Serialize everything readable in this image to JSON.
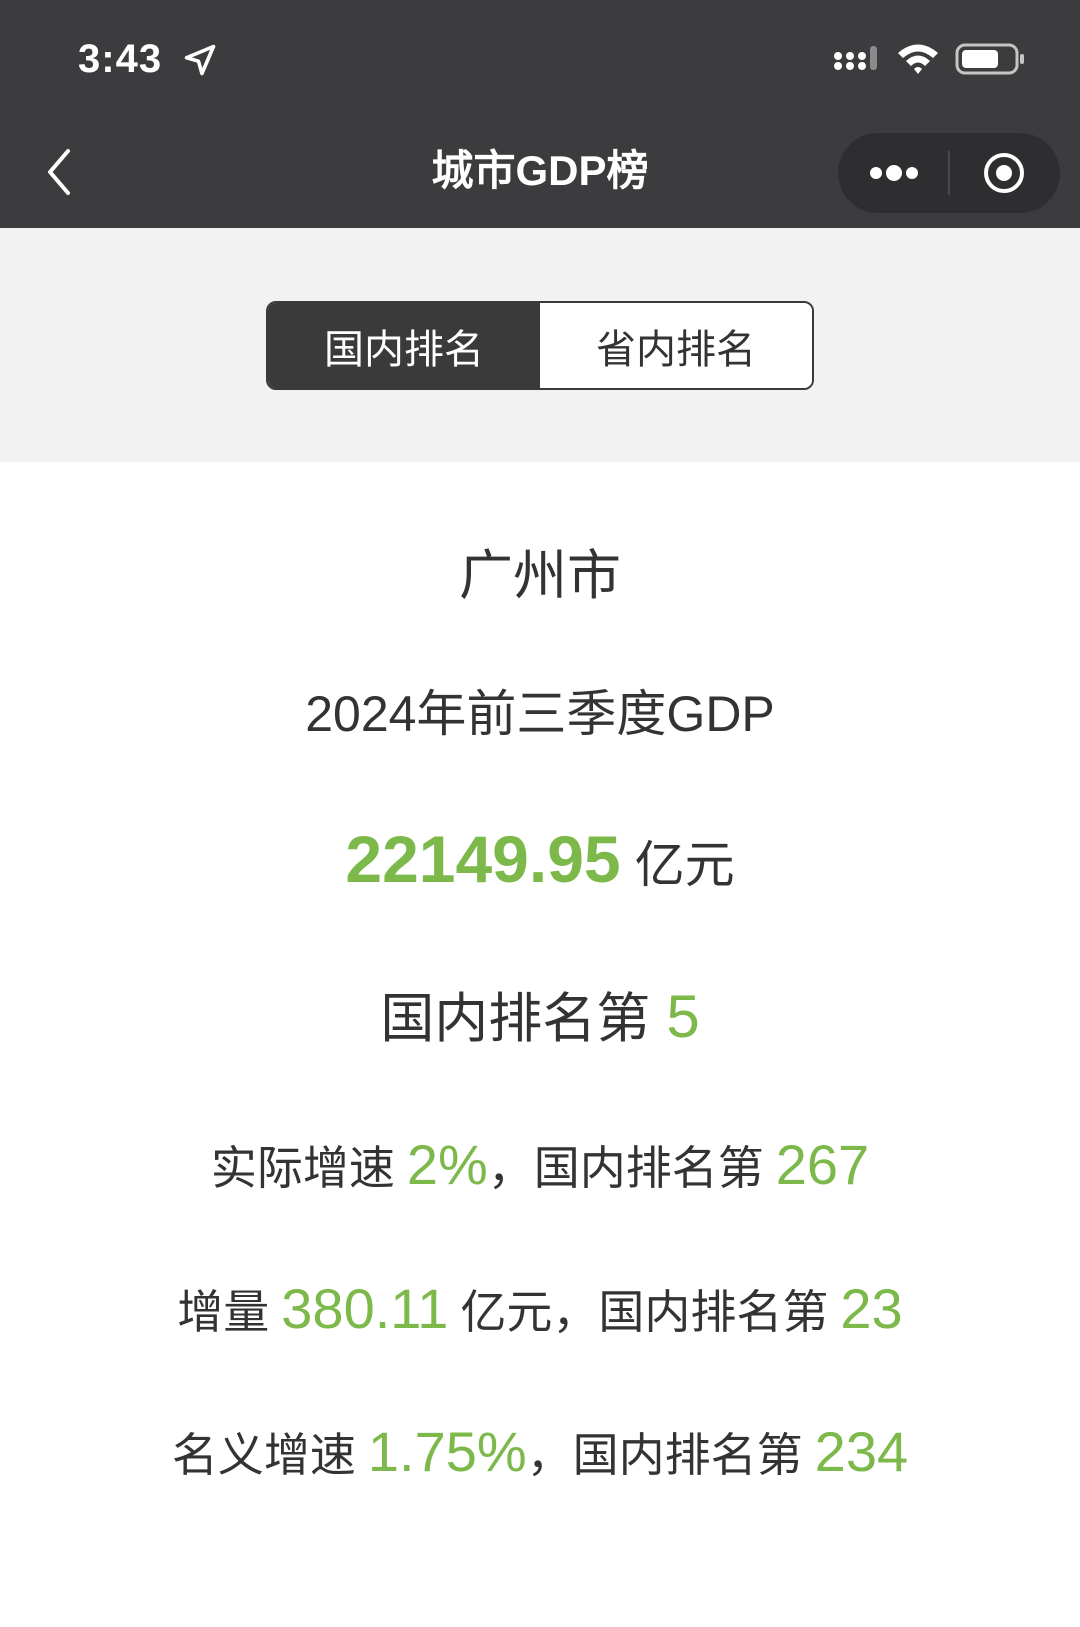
{
  "status_bar": {
    "time": "3:43",
    "icons": [
      "location-arrow-icon",
      "signal-icon",
      "wifi-icon",
      "battery-icon"
    ]
  },
  "nav": {
    "title": "城市GDP榜",
    "back_icon": "chevron-left-icon",
    "more_icon": "more-dots-icon",
    "close_icon": "target-circle-icon"
  },
  "tabs": [
    {
      "label": "国内排名",
      "selected": true
    },
    {
      "label": "省内排名",
      "selected": false
    }
  ],
  "city": "广州市",
  "period_label": "2024年前三季度GDP",
  "gdp": {
    "value": "22149.95",
    "unit": "亿元"
  },
  "national_rank": {
    "prefix": "国内排名第",
    "value": "5"
  },
  "real_growth": {
    "label": "实际增速",
    "value": "2%",
    "separator": "，",
    "rank_prefix": "国内排名第",
    "rank": "267"
  },
  "increment": {
    "label": "增量",
    "value": "380.11",
    "unit": "亿元",
    "separator": "，",
    "rank_prefix": "国内排名第",
    "rank": "23"
  },
  "nominal_growth": {
    "label": "名义增速",
    "value": "1.75%",
    "separator": "，",
    "rank_prefix": "国内排名第",
    "rank": "234"
  },
  "colors": {
    "accent_green": "#7cb84a",
    "dark_bar": "#3c3c3e",
    "text": "#333333",
    "page_gray": "#f2f2f2"
  }
}
